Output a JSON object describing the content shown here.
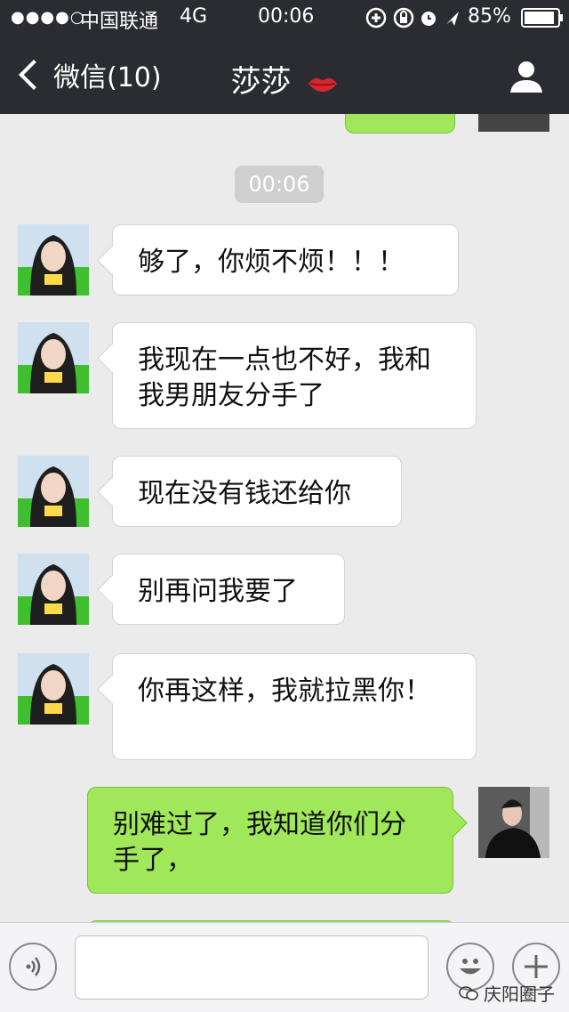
{
  "status_bar": {
    "signal": "●●●●○",
    "carrier": "中国联通",
    "network": "4G",
    "time": "00:06",
    "battery_percent": "85%"
  },
  "nav": {
    "back_label": "微信(10)",
    "title": "莎莎",
    "icons": [
      "back-chevron-icon",
      "lips-icon",
      "profile-icon"
    ]
  },
  "chat": {
    "timestamp": "00:06",
    "messages": [
      {
        "from": "friend",
        "text": "够了，你烦不烦！！！"
      },
      {
        "from": "friend",
        "line1": "我现在一点也不好，我和",
        "line2": "我男朋友分手了"
      },
      {
        "from": "friend",
        "text": "现在没有钱还给你"
      },
      {
        "from": "friend",
        "text": "别再问我要了"
      },
      {
        "from": "friend",
        "text": "你再这样，我就拉黑你！"
      },
      {
        "from": "me",
        "line1": "别难过了，我知道你们分",
        "line2": "手了，"
      }
    ]
  },
  "input_bar": {
    "icons": [
      "voice-icon",
      "emoji-icon",
      "plus-icon"
    ],
    "input_value": ""
  },
  "watermark": {
    "text": "庆阳圈子"
  },
  "colors": {
    "header_bg": "#2b2c31",
    "chat_bg": "#ebebeb",
    "my_bubble": "#a0e75a",
    "friend_bubble": "#ffffff"
  }
}
